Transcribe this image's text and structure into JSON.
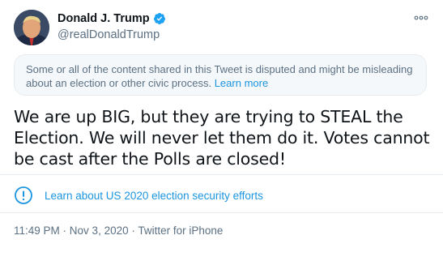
{
  "user": {
    "display_name": "Donald J. Trump",
    "handle": "@realDonaldTrump",
    "verified": true
  },
  "icons": {
    "verified": "verified-badge-icon",
    "more": "more-options-icon",
    "info": "info-circle-icon"
  },
  "notice": {
    "text": "Some or all of the content shared in this Tweet is disputed and might be misleading about an election or other civic process.",
    "link_text": "Learn more"
  },
  "tweet": {
    "text": "We are up BIG, but they are trying to STEAL the Election. We will never let them do it. Votes cannot be cast after the Polls are closed!"
  },
  "election_notice": {
    "link_text": "Learn about US 2020 election security efforts"
  },
  "meta": {
    "time": "11:49 PM",
    "separator": " · ",
    "date": "Nov 3, 2020",
    "source": "Twitter for iPhone"
  },
  "colors": {
    "accent": "#1b95e0",
    "secondary_text": "#5b7083",
    "notice_bg": "#f5f8fa",
    "border": "#e6ecf0"
  }
}
